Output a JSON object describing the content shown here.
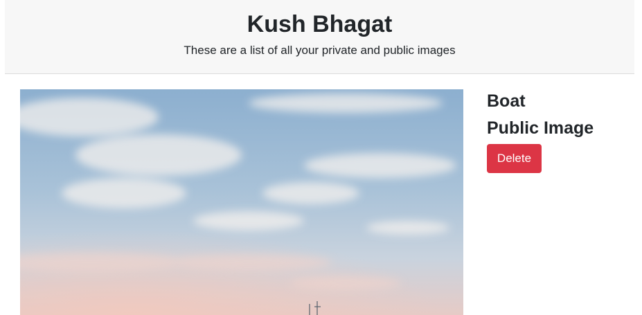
{
  "header": {
    "title": "Kush Bhagat",
    "subtitle": "These are a list of all your private and public images"
  },
  "image_card": {
    "name": "Boat",
    "visibility": "Public Image",
    "delete_label": "Delete"
  },
  "colors": {
    "danger": "#dc3545",
    "header_bg": "#f7f7f7",
    "sky_top": "#8fb0cf",
    "sky_horizon": "#e8c9c3"
  }
}
